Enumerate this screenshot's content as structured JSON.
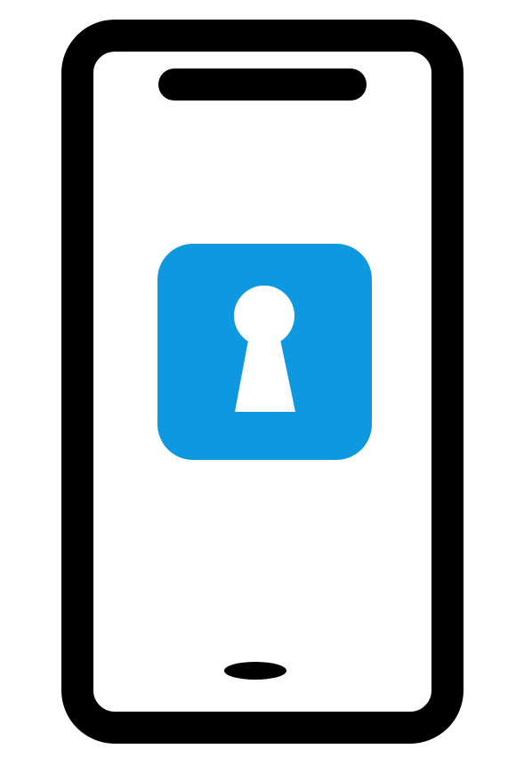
{
  "illustration": {
    "icon": "smartphone-lock-icon",
    "colors": {
      "background": "#ffffff",
      "outline": "#000000",
      "screen": "#ffffff",
      "lock_badge": "#0d98e0",
      "keyhole": "#ffffff"
    }
  }
}
